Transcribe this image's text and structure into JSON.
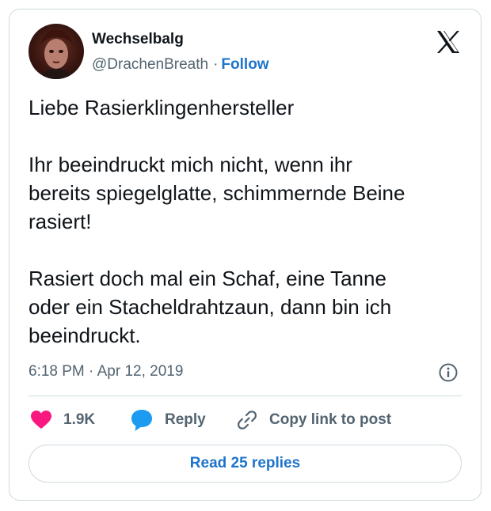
{
  "author": {
    "display_name": "Wechselbalg",
    "handle": "@DrachenBreath",
    "separator": "·",
    "follow_label": "Follow"
  },
  "tweet": {
    "text": "Liebe Rasierklingenhersteller\n\nIhr beeindruckt mich nicht, wenn ihr\nbereits spiegelglatte, schimmernde Beine\nrasiert!\n\nRasiert doch mal ein Schaf, eine Tanne\noder ein Stacheldrahtzaun, dann bin ich\nbeeindruckt.",
    "time": "6:18 PM",
    "separator": "·",
    "date": "Apr 12, 2019"
  },
  "actions": {
    "like_count": "1.9K",
    "reply_label": "Reply",
    "copy_label": "Copy link to post"
  },
  "footer": {
    "read_replies_label": "Read 25 replies"
  },
  "icons": {
    "platform_logo": "x-logo-icon",
    "info": "info-icon",
    "like": "heart-icon",
    "reply": "speech-bubble-icon",
    "copy": "link-icon"
  },
  "colors": {
    "accent": "#1d74c9",
    "like": "#f91880",
    "reply": "#1d9bf0",
    "muted_text": "#536471",
    "border": "#cfd9de"
  }
}
